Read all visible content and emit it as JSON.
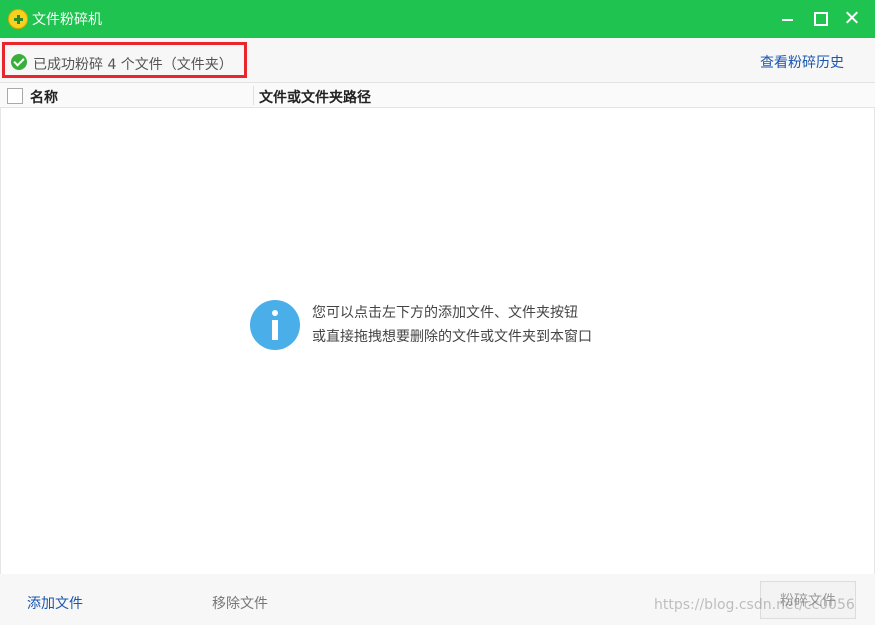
{
  "window": {
    "title": "文件粉碎机"
  },
  "status": {
    "message": "已成功粉碎 4 个文件（文件夹）",
    "history_link": "查看粉碎历史"
  },
  "table": {
    "columns": [
      "名称",
      "文件或文件夹路径"
    ]
  },
  "empty_state": {
    "line1": "您可以点击左下方的添加文件、文件夹按钮",
    "line2": "或直接拖拽想要删除的文件或文件夹到本窗口"
  },
  "footer": {
    "add_file": "添加文件",
    "remove_file": "移除文件",
    "shred_files": "粉碎文件"
  },
  "watermark": "https://blog.csdn.net/cc0056",
  "colors": {
    "titlebar": "#1fc34f",
    "highlight_border": "#e8262b",
    "link": "#1a56b0",
    "info_icon": "#4aaee8"
  },
  "icons": {
    "app": "shredder-app-icon",
    "status": "check-circle-icon",
    "empty_state": "info-icon"
  }
}
